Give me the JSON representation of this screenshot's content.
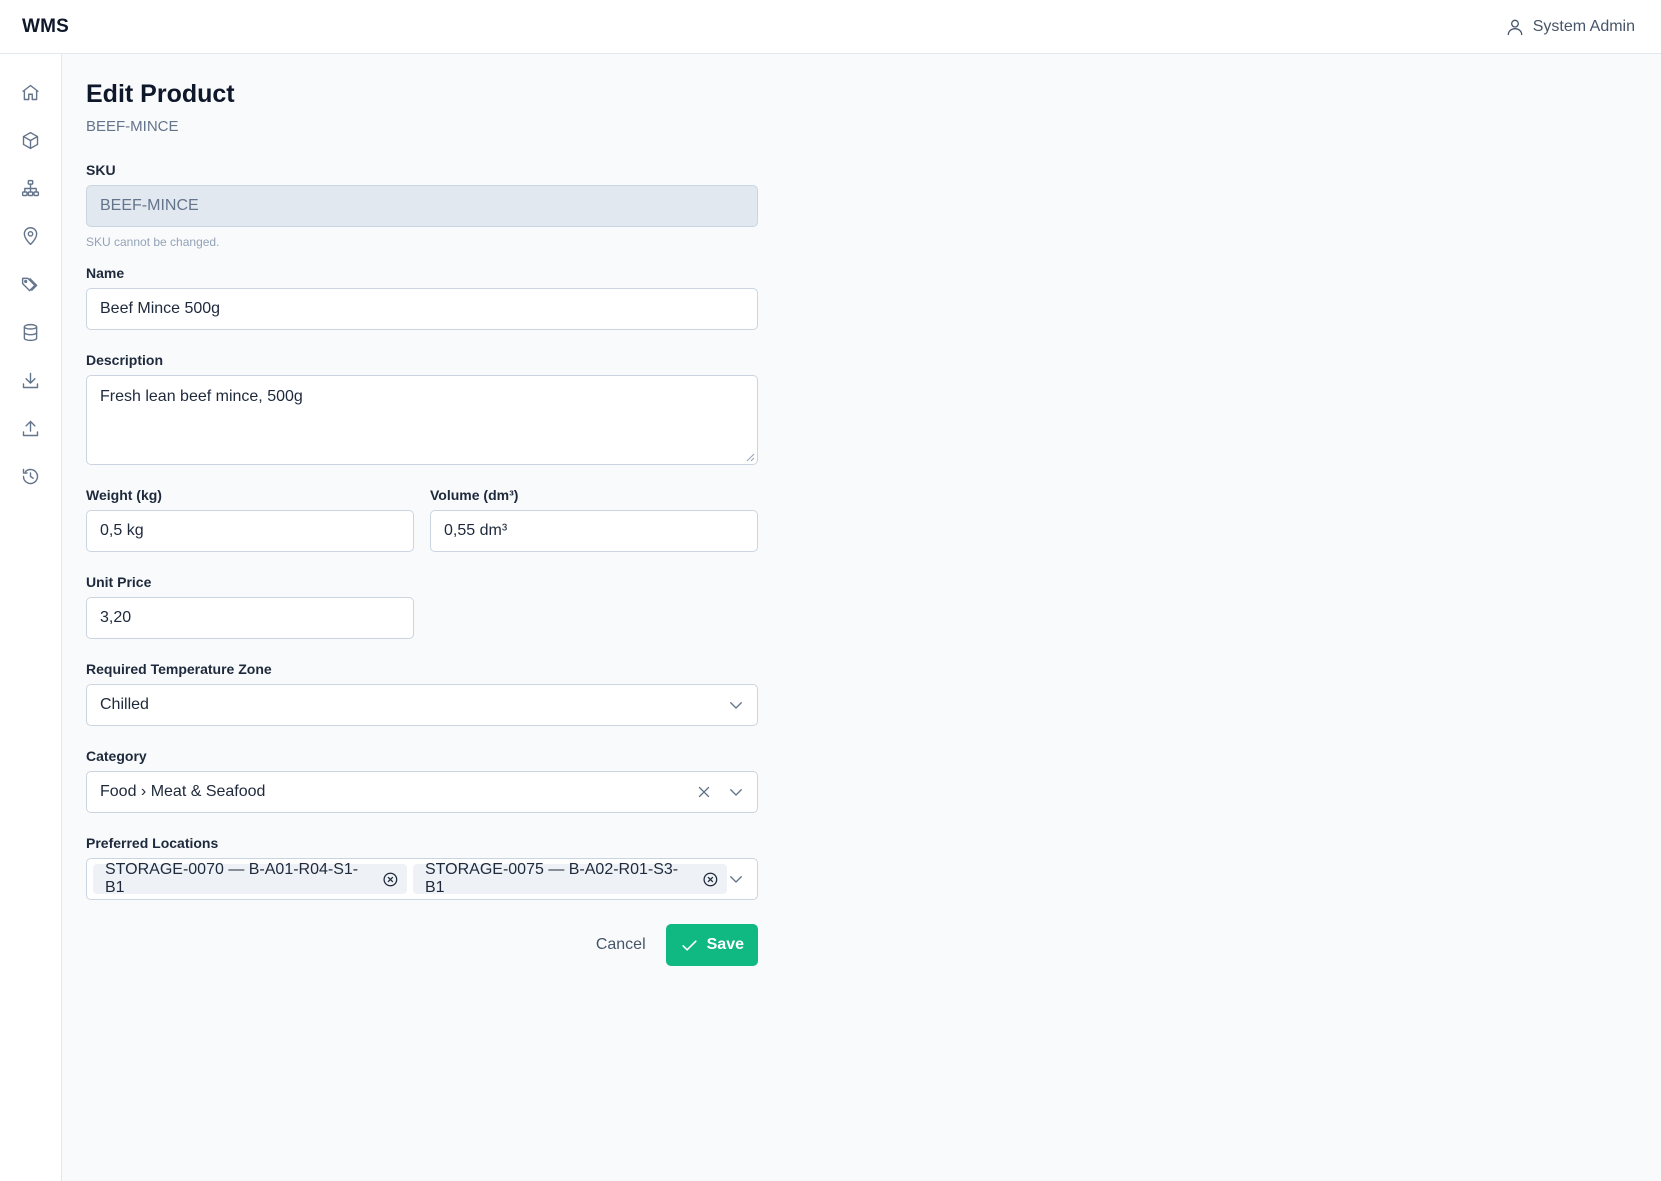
{
  "app": {
    "brand": "WMS",
    "user_name": "System Admin"
  },
  "sidebar": {
    "items": [
      {
        "name": "home",
        "icon": "home-icon"
      },
      {
        "name": "products",
        "icon": "box-icon"
      },
      {
        "name": "hierarchy",
        "icon": "sitemap-icon"
      },
      {
        "name": "locations",
        "icon": "map-pin-icon"
      },
      {
        "name": "categories",
        "icon": "tags-icon"
      },
      {
        "name": "database",
        "icon": "database-icon"
      },
      {
        "name": "inbound",
        "icon": "download-icon"
      },
      {
        "name": "outbound",
        "icon": "upload-icon"
      },
      {
        "name": "history",
        "icon": "history-icon"
      }
    ]
  },
  "page": {
    "title": "Edit Product",
    "subtitle": "BEEF-MINCE"
  },
  "form": {
    "sku": {
      "label": "SKU",
      "value": "BEEF-MINCE",
      "hint": "SKU cannot be changed."
    },
    "name": {
      "label": "Name",
      "value": "Beef Mince 500g"
    },
    "description": {
      "label": "Description",
      "value": "Fresh lean beef mince, 500g"
    },
    "weight": {
      "label": "Weight (kg)",
      "value": "0,5 kg"
    },
    "volume": {
      "label": "Volume (dm³)",
      "value": "0,55 dm³"
    },
    "unit_price": {
      "label": "Unit Price",
      "value": "3,20"
    },
    "temperature_zone": {
      "label": "Required Temperature Zone",
      "value": "Chilled"
    },
    "category": {
      "label": "Category",
      "value": "Food › Meat & Seafood"
    },
    "preferred_locations": {
      "label": "Preferred Locations",
      "values": [
        "STORAGE-0070 — B-A01-R04-S1-B1",
        "STORAGE-0075 — B-A02-R01-S3-B1"
      ]
    }
  },
  "actions": {
    "cancel_label": "Cancel",
    "save_label": "Save"
  },
  "colors": {
    "accent": "#10b981",
    "background": "#f8fafc",
    "border": "#cbd5e1"
  }
}
